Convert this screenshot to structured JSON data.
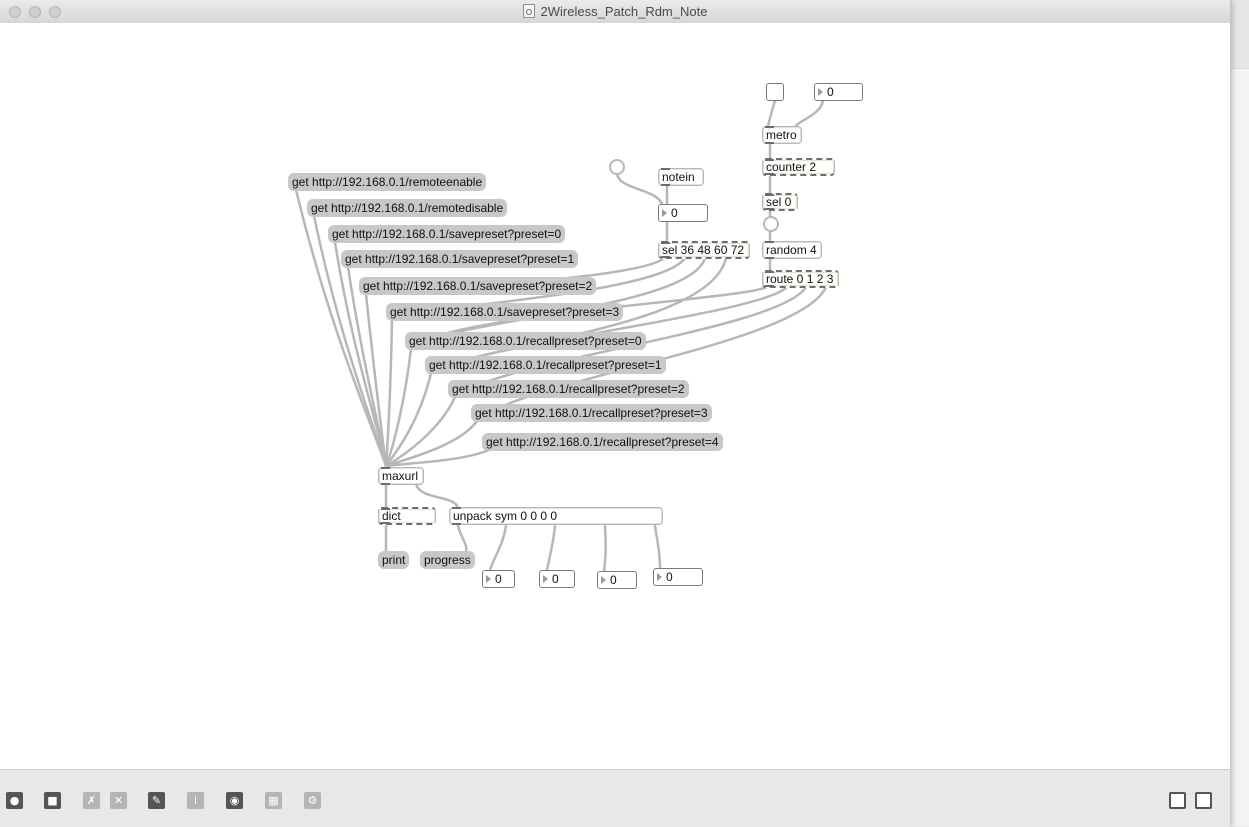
{
  "window": {
    "title": "2Wireless_Patch_Rdm_Note",
    "traffic_lights": [
      "close",
      "minimize",
      "zoom"
    ]
  },
  "patch": {
    "message_boxes": {
      "remoteenable": "get http://192.168.0.1/remoteenable",
      "remotedisable": "get http://192.168.0.1/remotedisable",
      "savepreset0": "get http://192.168.0.1/savepreset?preset=0",
      "savepreset1": "get http://192.168.0.1/savepreset?preset=1",
      "savepreset2": "get http://192.168.0.1/savepreset?preset=2",
      "savepreset3": "get http://192.168.0.1/savepreset?preset=3",
      "recallpreset0": "get http://192.168.0.1/recallpreset?preset=0",
      "recallpreset1": "get http://192.168.0.1/recallpreset?preset=1",
      "recallpreset2": "get http://192.168.0.1/recallpreset?preset=2",
      "recallpreset3": "get http://192.168.0.1/recallpreset?preset=3",
      "recallpreset4": "get http://192.168.0.1/recallpreset?preset=4",
      "print": "print",
      "progress": "progress"
    },
    "objects": {
      "notein": "notein",
      "sel_notes": "sel 36 48 60 72",
      "metro": "metro",
      "counter": "counter 2",
      "sel0": "sel 0",
      "random": "random 4",
      "route": "route 0 1 2 3",
      "maxurl": "maxurl",
      "dict": "dict",
      "unpack": "unpack sym 0 0 0 0"
    },
    "number_boxes": {
      "metro_interval": "0",
      "note_value": "0",
      "unpack_out1": "0",
      "unpack_out2": "0",
      "unpack_out3": "0",
      "unpack_out4": "0"
    }
  },
  "toolbar": {
    "icons": [
      "lock-icon",
      "presentation-mode-icon",
      "debug-icon",
      "clear-icon",
      "patcher-inspector-icon",
      "info-icon",
      "object-palette-icon",
      "grid-icon",
      "snap-icon"
    ],
    "right_icons": [
      "bottom-panel-icon",
      "right-panel-icon"
    ]
  }
}
